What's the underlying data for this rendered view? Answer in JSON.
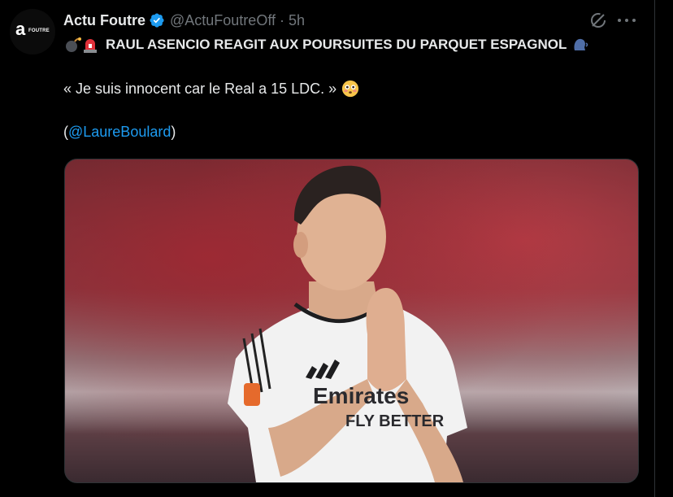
{
  "tweet": {
    "author_name": "Actu Foutre",
    "handle": "@ActuFoutreOff",
    "separator": "·",
    "time": "5h",
    "headline": "RAUL ASENCIO REAGIT AUX POURSUITES DU PARQUET ESPAGNOL",
    "quote": "« Je suis innocent car le Real a 15 LDC. »",
    "mention_open": "(",
    "mention": "@LaureBoulard",
    "mention_close": ")",
    "avatar": {
      "letter": "a",
      "text": "FOUTRE"
    },
    "image_jersey_text_1": "Emirates",
    "image_jersey_text_2": "FLY BETTER"
  },
  "icons": [
    "verified-badge-icon",
    "grok-icon",
    "more-icon",
    "bomb-emoji",
    "rotating-light-emoji",
    "speaking-head-emoji",
    "flushed-face-emoji"
  ],
  "colors": {
    "background": "#000000",
    "text": "#e7e9ea",
    "muted": "#71767b",
    "link": "#1d9bf0",
    "verified": "#1d9bf0"
  }
}
